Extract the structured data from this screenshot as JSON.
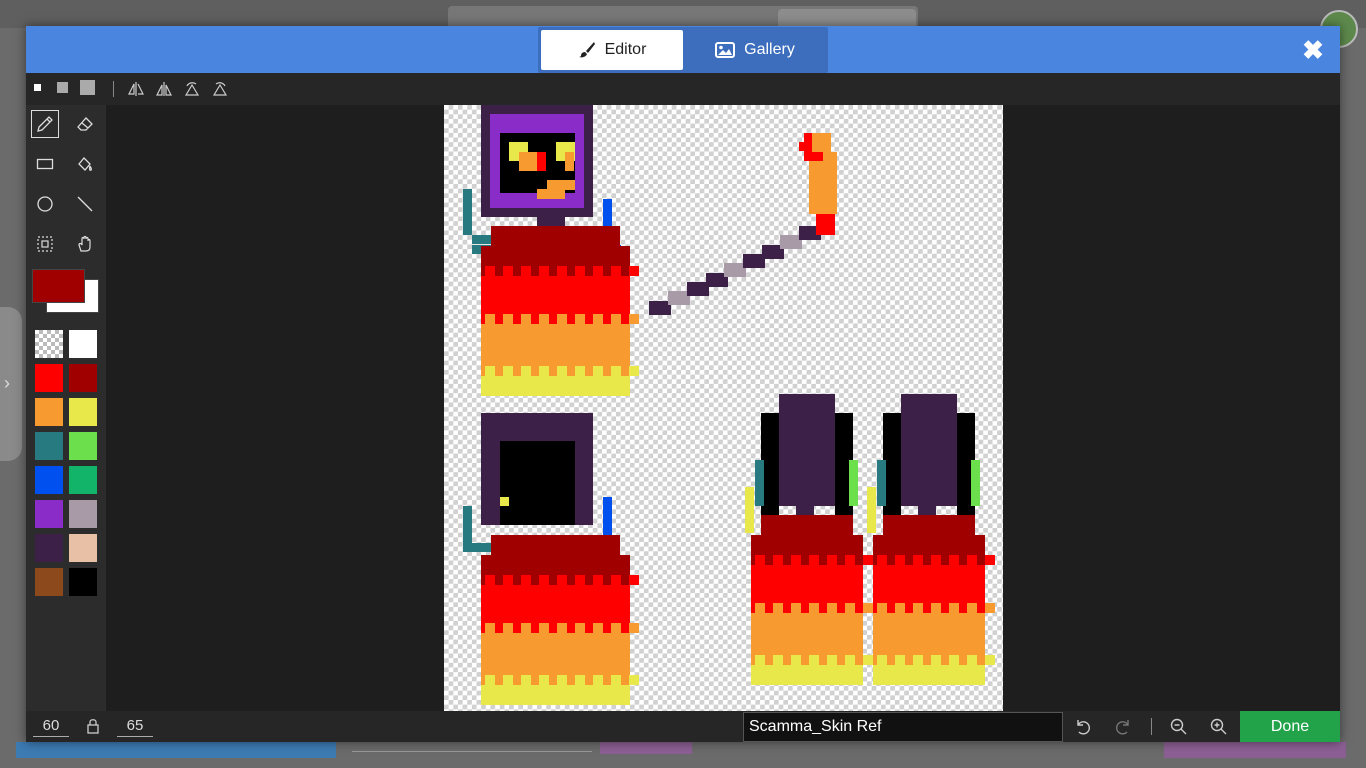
{
  "header": {
    "tabs": [
      {
        "label": "Editor",
        "icon": "brush-icon",
        "active": true
      },
      {
        "label": "Gallery",
        "icon": "image-icon",
        "active": false
      }
    ],
    "close_icon": "close-icon"
  },
  "toolbar": {
    "brush_sizes": [
      "small",
      "medium",
      "large"
    ],
    "tools": [
      "flip-horizontal-icon",
      "flip-vertical-icon",
      "rotate-left-icon",
      "rotate-right-icon"
    ]
  },
  "sidebar": {
    "tools": [
      "pencil-icon",
      "eraser-icon",
      "rectangle-icon",
      "fill-bucket-icon",
      "ellipse-icon",
      "line-icon",
      "select-icon",
      "pan-hand-icon"
    ],
    "primary_color": "#a00000",
    "secondary_color": "#ffffff",
    "palette": [
      "transparent",
      "#ffffff",
      "#ff0000",
      "#a00000",
      "#f79a30",
      "#e8e84a",
      "#267a80",
      "#6be04c",
      "#0050f0",
      "#12b46a",
      "#8a2dc8",
      "#a89aa6",
      "#3c2048",
      "#e8c0a6",
      "#8c4a1c",
      "#000000"
    ]
  },
  "status": {
    "width": "60",
    "height": "65",
    "file_name": "Scamma_Skin Ref",
    "done_label": "Done"
  }
}
